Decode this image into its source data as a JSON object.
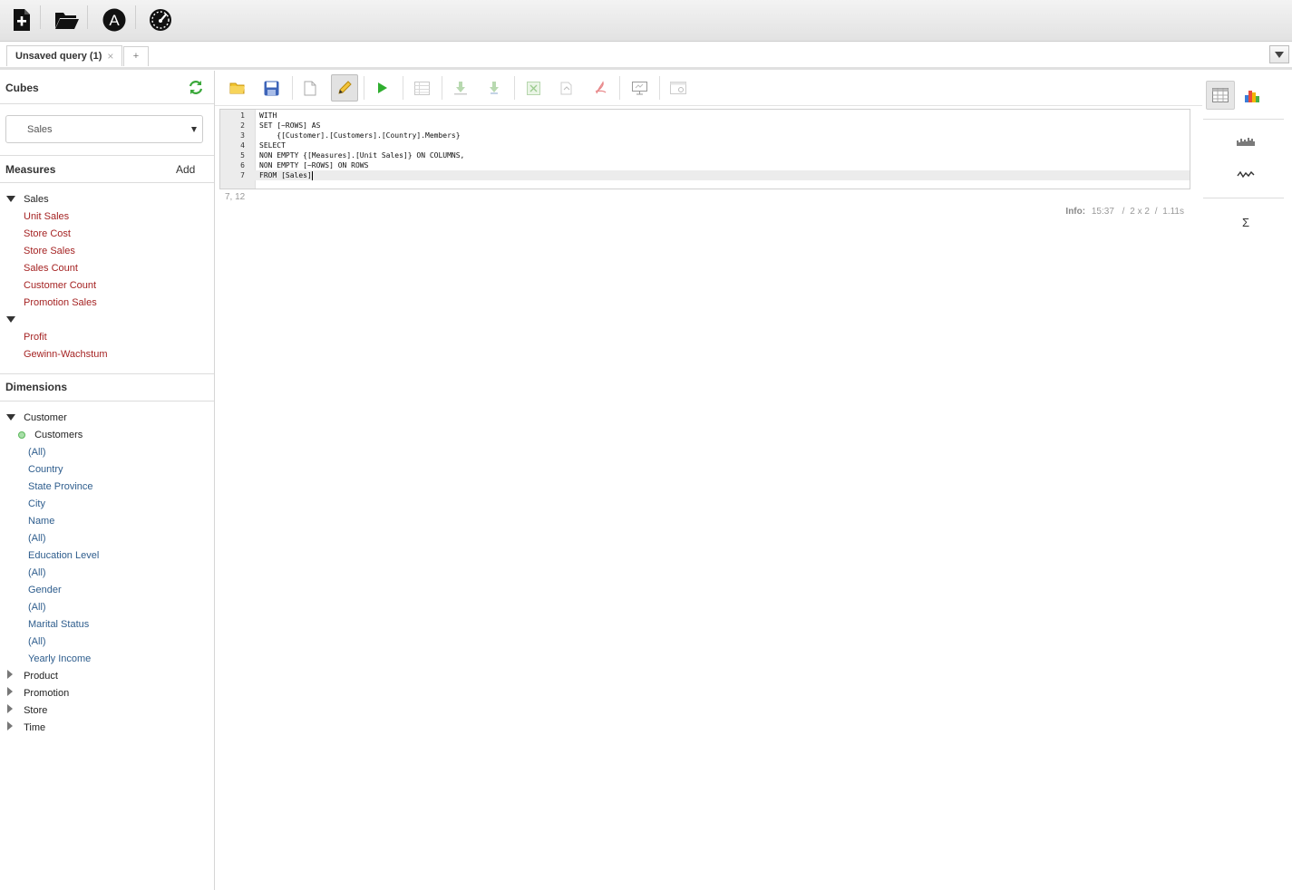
{
  "topbar": {
    "buttons": [
      {
        "icon": "new-query-icon",
        "label": "New query"
      },
      {
        "icon": "open-folder-icon",
        "label": "Open"
      },
      {
        "icon": "admin-icon",
        "label": "A"
      },
      {
        "icon": "dashboard-gauge-icon",
        "label": "Status"
      }
    ]
  },
  "tabs": {
    "active_label": "Unsaved query (1)",
    "close_glyph": "×",
    "add_glyph": "+"
  },
  "sidebar": {
    "cubes_title": "Cubes",
    "cube_selected": "Sales",
    "measures_title": "Measures",
    "add_label": "Add",
    "measure_groups": [
      {
        "name": "Sales",
        "items": [
          "Unit Sales",
          "Store Cost",
          "Store Sales",
          "Sales Count",
          "Customer Count",
          "Promotion Sales"
        ]
      },
      {
        "name": "",
        "items": [
          "Profit",
          "Gewinn-Wachstum"
        ]
      }
    ],
    "dimensions_title": "Dimensions",
    "dimension_customer": "Customer",
    "hierarchy_customers": "Customers",
    "customer_levels": [
      "(All)",
      "Country",
      "State Province",
      "City",
      "Name",
      "(All)",
      "Education Level",
      "(All)",
      "Gender",
      "(All)",
      "Marital Status",
      "(All)",
      "Yearly Income"
    ],
    "collapsed_dimensions": [
      "Product",
      "Promotion",
      "Store",
      "Time"
    ]
  },
  "editor": {
    "lines": [
      "WITH",
      "SET [~ROWS] AS",
      "    {[Customer].[Customers].[Country].Members}",
      "SELECT",
      "NON EMPTY {[Measures].[Unit Sales]} ON COLUMNS,",
      "NON EMPTY [~ROWS] ON ROWS",
      "FROM [Sales]"
    ],
    "line_numbers": [
      "1",
      "2",
      "3",
      "4",
      "5",
      "6",
      "7"
    ],
    "cursor_position": "7, 12"
  },
  "info": {
    "label": "Info:",
    "time": "15:37",
    "dims": "2 x 2",
    "duration": "1.11s",
    "sep": "/"
  },
  "rail": {
    "sum_glyph": "Σ"
  },
  "colors": {
    "measure": "#a52323",
    "level": "#2e5d8d",
    "run_green": "#2fae2f",
    "hierarchy_dot": "#5cb85c"
  }
}
